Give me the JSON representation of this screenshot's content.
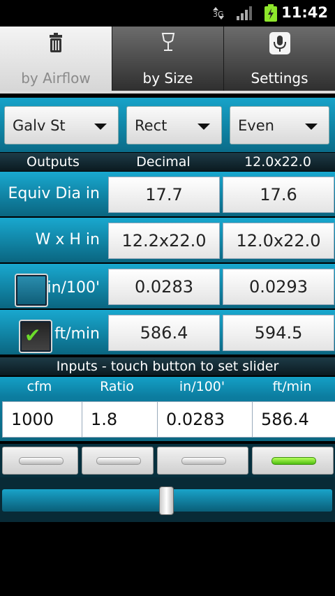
{
  "status_bar": {
    "network": "3G",
    "time": "11:42"
  },
  "tabs": [
    {
      "label": "by Airflow",
      "icon": "trash-can-icon",
      "active": true
    },
    {
      "label": "by Size",
      "icon": "wine-glass-icon",
      "active": false
    },
    {
      "label": "Settings",
      "icon": "microphone-icon",
      "active": false
    }
  ],
  "dropdowns": {
    "material": "Galv St",
    "shape": "Rect",
    "rounding": "Even"
  },
  "outputs_header": {
    "col1": "Outputs",
    "col2": "Decimal",
    "col3": "12.0x22.0"
  },
  "outputs": [
    {
      "label": "Equiv Dia in",
      "decimal": "17.7",
      "size": "17.6"
    },
    {
      "label": "W x H in",
      "decimal": "12.2x22.0",
      "size": "12.0x22.0"
    },
    {
      "label": "in/100'",
      "decimal": "0.0283",
      "size": "0.0293",
      "checked": false
    },
    {
      "label": "ft/min",
      "decimal": "586.4",
      "size": "594.5",
      "checked": true
    }
  ],
  "inputs_title": "Inputs - touch button to set slider",
  "inputs": [
    {
      "header": "cfm",
      "value": "1000",
      "selected": false
    },
    {
      "header": "Ratio",
      "value": "1.8",
      "selected": false
    },
    {
      "header": "in/100'",
      "value": "0.0283",
      "selected": false
    },
    {
      "header": "ft/min",
      "value": "586.4",
      "selected": true
    }
  ],
  "slider": {
    "value_fraction": 0.5
  },
  "colors": {
    "accent": "#1396bd",
    "active_indicator": "#7ed321"
  }
}
